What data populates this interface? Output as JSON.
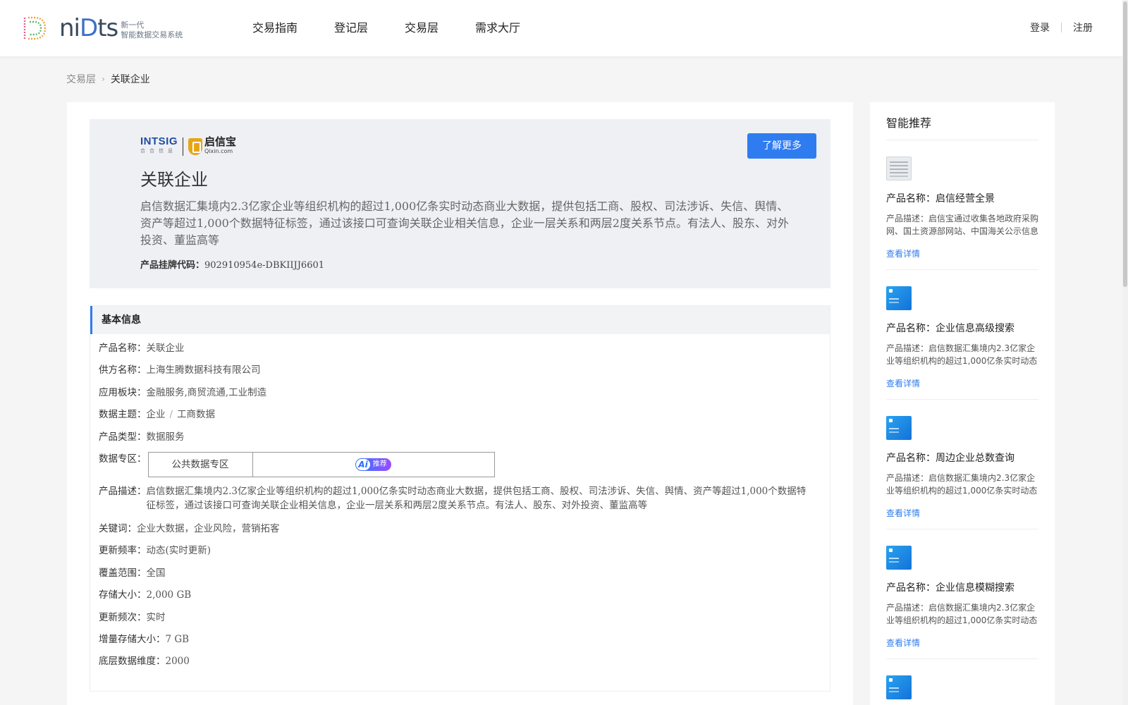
{
  "header": {
    "logo_word_a": "ni",
    "logo_word_b": "D",
    "logo_word_c": "ts",
    "logo_sub_1": "新一代",
    "logo_sub_2": "智能数据交易系统",
    "nav": [
      "交易指南",
      "登记层",
      "交易层",
      "需求大厅"
    ],
    "login": "登录",
    "register": "注册"
  },
  "breadcrumb": {
    "parent": "交易层",
    "arrow": ">",
    "current": "关联企业"
  },
  "hero": {
    "brand_intsig": "INTSIG",
    "brand_intsig_sub": "合合信息",
    "brand_qixin": "启信宝",
    "brand_qixin_sub": "Qixin.com",
    "learn_more": "了解更多",
    "title": "关联企业",
    "description": "启信数据汇集境内2.3亿家企业等组织机构的超过1,000亿条实时动态商业大数据，提供包括工商、股权、司法涉诉、失信、舆情、资产等超过1,000个数据特征标签，通过该接口可查询关联企业相关信息，企业一层关系和两层2度关系节点。有法人、股东、对外投资、董监高等",
    "code_label": "产品挂牌代码：",
    "code_value": "902910954e-DBKIIJJ6601"
  },
  "basic": {
    "heading": "基本信息",
    "product_name_k": "产品名称：",
    "product_name_v": "关联企业",
    "supplier_k": "供方名称：",
    "supplier_v": "上海生腾数据科技有限公司",
    "sector_k": "应用板块：",
    "sector_v": "金融服务,商贸流通,工业制造",
    "theme_k": "数据主题：",
    "theme_v1": "企业",
    "theme_sep": "/",
    "theme_v2": "工商数据",
    "type_k": "产品类型：",
    "type_v": "数据服务",
    "zone_k": "数据专区：",
    "zone_v": "公共数据专区",
    "zone_ai": "Ai",
    "zone_ai_text": "推荐",
    "desc_k": "产品描述：",
    "desc_v": "启信数据汇集境内2.3亿家企业等组织机构的超过1,000亿条实时动态商业大数据，提供包括工商、股权、司法涉诉、失信、舆情、资产等超过1,000个数据特征标签，通过该接口可查询关联企业相关信息，企业一层关系和两层2度关系节点。有法人、股东、对外投资、董监高等",
    "kw_k": "关键词：",
    "kw_v": "企业大数据，企业风险，营销拓客",
    "freq_k": "更新频率：",
    "freq_v": "动态(实时更新)",
    "cover_k": "覆盖范围：",
    "cover_v": "全国",
    "size_k": "存储大小：",
    "size_v": "2,000 GB",
    "times_k": "更新频次：",
    "times_v": "实时",
    "inc_k": "增量存储大小：",
    "inc_v": "7 GB",
    "dim_k": "底层数据维度：",
    "dim_v": "2000"
  },
  "side": {
    "title": "智能推荐",
    "cards": [
      {
        "name": "产品名称：启信经营全景",
        "desc": "产品描述：启信宝通过收集各地政府采购网、国土资源部网站、中国海关公示信息等",
        "link": "查看详情",
        "thumb": "document-thumbnail"
      },
      {
        "name": "产品名称：企业信息高级搜索",
        "desc": "产品描述：启信数据汇集境内2.3亿家企业等组织机构的超过1,000亿条实时动态商业大数据",
        "link": "查看详情",
        "thumb": "blue-thumbnail"
      },
      {
        "name": "产品名称：周边企业总数查询",
        "desc": "产品描述：启信数据汇集境内2.3亿家企业等组织机构的超过1,000亿条实时动态商业大数据",
        "link": "查看详情",
        "thumb": "blue-thumbnail"
      },
      {
        "name": "产品名称：企业信息模糊搜索",
        "desc": "产品描述：启信数据汇集境内2.3亿家企业等组织机构的超过1,000亿条实时动态商业大数据",
        "link": "查看详情",
        "thumb": "blue-thumbnail"
      }
    ]
  },
  "colors": {
    "accent": "#2f7cf0",
    "hero_bg": "#eef0f4",
    "page_bg": "#f5f5f5"
  }
}
